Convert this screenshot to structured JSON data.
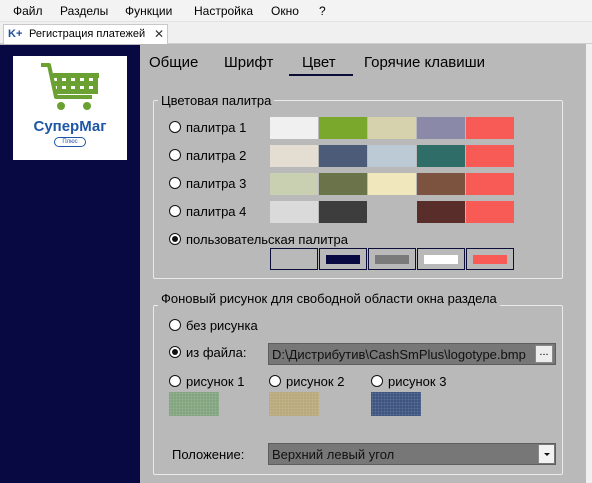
{
  "menu": [
    "Файл",
    "Разделы",
    "Функции",
    "Настройка",
    "Окно",
    "?"
  ],
  "document_tab": {
    "prefix": "K+",
    "label": "Регистрация платежей",
    "close": "✕"
  },
  "logo": {
    "title": "СуперМаг",
    "subtitle": "Плюс"
  },
  "settings_tabs": {
    "items": [
      "Общие",
      "Шрифт",
      "Цвет",
      "Горячие клавиши"
    ],
    "active": "Цвет"
  },
  "palette_group": {
    "title": "Цветовая палитра",
    "palettes": [
      {
        "label": "палитра 1",
        "selected": false,
        "colors": [
          "#f0f0f0",
          "#7aa82c",
          "#d6d2ad",
          "#8a8aa8",
          "#f85a55"
        ]
      },
      {
        "label": "палитра 2",
        "selected": false,
        "colors": [
          "#e4ddd2",
          "#4c5c78",
          "#bccad6",
          "#2f6e68",
          "#f85a55"
        ]
      },
      {
        "label": "палитра 3",
        "selected": false,
        "colors": [
          "#c9d0b2",
          "#6a7349",
          "#f1e7bd",
          "#7c533f",
          "#f85a55"
        ]
      },
      {
        "label": "палитра 4",
        "selected": false,
        "colors": [
          "#dadada",
          "#3d3d3d",
          "#b9b9b9",
          "#592d29",
          "#f85a55"
        ]
      }
    ],
    "custom": {
      "label": "пользовательская палитра",
      "selected": true,
      "colors": [
        "#b9b9b9",
        "#080842",
        "#7a7a7a",
        "#ffffff",
        "#f85a55"
      ]
    }
  },
  "background_group": {
    "title": "Фоновый рисунок для свободной области окна раздела",
    "no_image_label": "без рисунка",
    "no_image_selected": false,
    "from_file_label": "из файла:",
    "from_file_selected": true,
    "file_path": "D:\\Дистрибутив\\CashSmPlus\\logotype.bmp",
    "browse_label": "...",
    "patterns": [
      {
        "label": "рисунок 1",
        "selected": false,
        "color": "#7fa27c"
      },
      {
        "label": "рисунок 2",
        "selected": false,
        "color": "#b8a678"
      },
      {
        "label": "рисунок 3",
        "selected": false,
        "color": "#38507d"
      }
    ],
    "position_label": "Положение:",
    "position_value": "Верхний левый угол"
  },
  "colors": {
    "sidebar": "#080842",
    "panel": "#b9b9b9",
    "brand_blue": "#1e57a6",
    "cart_green": "#6aa132"
  }
}
